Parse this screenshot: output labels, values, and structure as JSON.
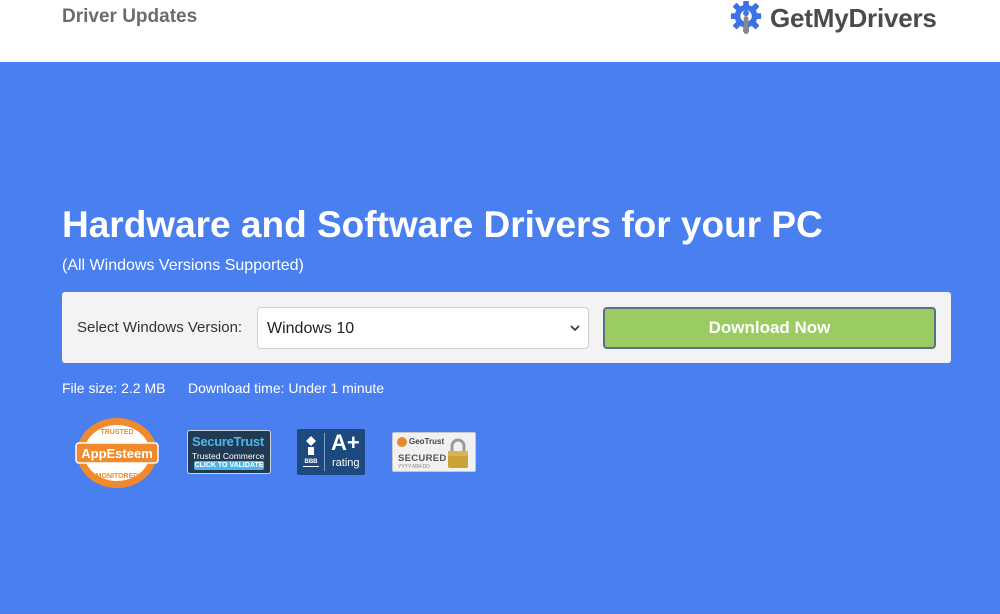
{
  "header": {
    "title": "Driver Updates",
    "logo_text": "GetMyDrivers",
    "logo_icon": "gear-wrench-icon"
  },
  "hero": {
    "headline": "Hardware and Software Drivers for your PC",
    "subline": "(All Windows Versions Supported)"
  },
  "form": {
    "select_label": "Select Windows Version:",
    "selected_version": "Windows 10",
    "download_label": "Download Now"
  },
  "meta": {
    "file_size": "File size: 2.2 MB",
    "download_time": "Download time: Under 1 minute"
  },
  "badges": {
    "appesteem": {
      "top": "TRUSTED",
      "name": "AppEsteem",
      "bottom": "MONITORED"
    },
    "securetrust": {
      "line1": "SecureTrust",
      "line2": "Trusted Commerce",
      "line3": "CLICK TO VALIDATE"
    },
    "bbb": {
      "grade": "A+",
      "rating": "rating"
    },
    "geotrust": {
      "brand": "GeoTrust",
      "secured": "SECURED",
      "date": "YYYY-MM-DD"
    }
  },
  "colors": {
    "background": "#4a7ff0",
    "button": "#9bcc63",
    "brand_blue": "#3b73e6"
  }
}
